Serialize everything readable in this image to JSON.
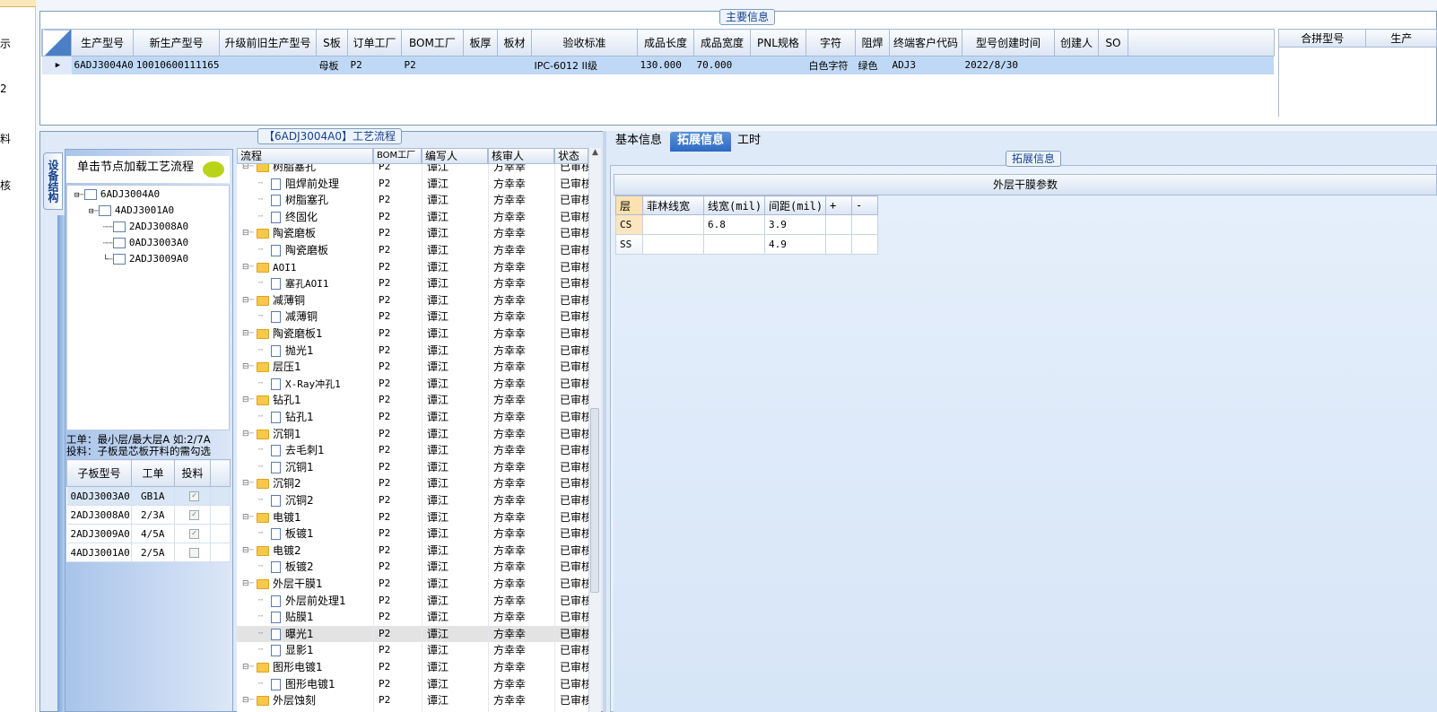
{
  "left_strip": {
    "stub1": "示",
    "stub2": "2",
    "stub3": "料",
    "stub4": "核"
  },
  "main_legend": "主要信息",
  "main_table": {
    "headers": [
      "生产型号",
      "新生产型号",
      "升级前旧生产型号",
      "S板",
      "订单工厂",
      "BOM工厂",
      "板厚",
      "板材",
      "验收标准",
      "成品长度",
      "成品宽度",
      "PNL规格",
      "字符",
      "阻焊",
      "终端客户代码",
      "型号创建时间",
      "创建人",
      "SO"
    ],
    "row": [
      "6ADJ3004A0",
      "10010600111165",
      "",
      "母板",
      "P2",
      "P2",
      "",
      "",
      "IPC-6012 II级",
      "130.000",
      "70.000",
      "",
      "白色字符",
      "绿色",
      "ADJ3",
      "2022/8/30",
      "",
      ""
    ]
  },
  "right_header": {
    "col1": "合拼型号",
    "col2": "生产"
  },
  "process_legend": "【6ADJ3004A0】工艺流程",
  "vtab_label": "设备结构",
  "tree_title": "单击节点加载工艺流程",
  "tree": {
    "root": "6ADJ3004A0",
    "child": "4ADJ3001A0",
    "leaf1": "2ADJ3008A0",
    "leaf2": "0ADJ3003A0",
    "leaf3": "2ADJ3009A0"
  },
  "info_line1": "工单：最小层/最大层A 如:2/7A",
  "info_line2": "投料：子板是芯板开料的需勾选",
  "sub_table": {
    "headers": [
      "子板型号",
      "工单",
      "投料"
    ],
    "rows": [
      {
        "model": "0ADJ3003A0",
        "order": "GB1A",
        "checked": true
      },
      {
        "model": "2ADJ3008A0",
        "order": "2/3A",
        "checked": true
      },
      {
        "model": "2ADJ3009A0",
        "order": "4/5A",
        "checked": true
      },
      {
        "model": "4ADJ3001A0",
        "order": "2/5A",
        "checked": false
      }
    ]
  },
  "process_headers": [
    "流程",
    "BOM工厂",
    "编写人",
    "核审人",
    "状态"
  ],
  "process_rows": [
    {
      "name": "树脂塞孔",
      "type": "folder",
      "bom": "P2",
      "writer": "谭江",
      "reviewer": "方幸幸",
      "status": "已审核"
    },
    {
      "name": "阻焊前处理",
      "type": "doc",
      "bom": "P2",
      "writer": "谭江",
      "reviewer": "方幸幸",
      "status": "已审核"
    },
    {
      "name": "树脂塞孔",
      "type": "doc",
      "bom": "P2",
      "writer": "谭江",
      "reviewer": "方幸幸",
      "status": "已审核"
    },
    {
      "name": "终固化",
      "type": "doc",
      "bom": "P2",
      "writer": "谭江",
      "reviewer": "方幸幸",
      "status": "已审核"
    },
    {
      "name": "陶瓷磨板",
      "type": "folder",
      "bom": "P2",
      "writer": "谭江",
      "reviewer": "方幸幸",
      "status": "已审核"
    },
    {
      "name": "陶瓷磨板",
      "type": "doc",
      "bom": "P2",
      "writer": "谭江",
      "reviewer": "方幸幸",
      "status": "已审核"
    },
    {
      "name": "AOI1",
      "type": "folder",
      "bom": "P2",
      "writer": "谭江",
      "reviewer": "方幸幸",
      "status": "已审核"
    },
    {
      "name": "塞孔AOI1",
      "type": "doc",
      "bom": "P2",
      "writer": "谭江",
      "reviewer": "方幸幸",
      "status": "已审核"
    },
    {
      "name": "减薄铜",
      "type": "folder",
      "bom": "P2",
      "writer": "谭江",
      "reviewer": "方幸幸",
      "status": "已审核"
    },
    {
      "name": "减薄铜",
      "type": "doc",
      "bom": "P2",
      "writer": "谭江",
      "reviewer": "方幸幸",
      "status": "已审核"
    },
    {
      "name": "陶瓷磨板1",
      "type": "folder",
      "bom": "P2",
      "writer": "谭江",
      "reviewer": "方幸幸",
      "status": "已审核"
    },
    {
      "name": "抛光1",
      "type": "doc",
      "bom": "P2",
      "writer": "谭江",
      "reviewer": "方幸幸",
      "status": "已审核"
    },
    {
      "name": "层压1",
      "type": "folder",
      "bom": "P2",
      "writer": "谭江",
      "reviewer": "方幸幸",
      "status": "已审核"
    },
    {
      "name": "X-Ray冲孔1",
      "type": "doc",
      "bom": "P2",
      "writer": "谭江",
      "reviewer": "方幸幸",
      "status": "已审核"
    },
    {
      "name": "钻孔1",
      "type": "folder",
      "bom": "P2",
      "writer": "谭江",
      "reviewer": "方幸幸",
      "status": "已审核"
    },
    {
      "name": "钻孔1",
      "type": "doc",
      "bom": "P2",
      "writer": "谭江",
      "reviewer": "方幸幸",
      "status": "已审核"
    },
    {
      "name": "沉铜1",
      "type": "folder",
      "bom": "P2",
      "writer": "谭江",
      "reviewer": "方幸幸",
      "status": "已审核"
    },
    {
      "name": "去毛刺1",
      "type": "doc",
      "bom": "P2",
      "writer": "谭江",
      "reviewer": "方幸幸",
      "status": "已审核"
    },
    {
      "name": "沉铜1",
      "type": "doc",
      "bom": "P2",
      "writer": "谭江",
      "reviewer": "方幸幸",
      "status": "已审核"
    },
    {
      "name": "沉铜2",
      "type": "folder",
      "bom": "P2",
      "writer": "谭江",
      "reviewer": "方幸幸",
      "status": "已审核"
    },
    {
      "name": "沉铜2",
      "type": "doc",
      "bom": "P2",
      "writer": "谭江",
      "reviewer": "方幸幸",
      "status": "已审核"
    },
    {
      "name": "电镀1",
      "type": "folder",
      "bom": "P2",
      "writer": "谭江",
      "reviewer": "方幸幸",
      "status": "已审核"
    },
    {
      "name": "板镀1",
      "type": "doc",
      "bom": "P2",
      "writer": "谭江",
      "reviewer": "方幸幸",
      "status": "已审核"
    },
    {
      "name": "电镀2",
      "type": "folder",
      "bom": "P2",
      "writer": "谭江",
      "reviewer": "方幸幸",
      "status": "已审核"
    },
    {
      "name": "板镀2",
      "type": "doc",
      "bom": "P2",
      "writer": "谭江",
      "reviewer": "方幸幸",
      "status": "已审核"
    },
    {
      "name": "外层干膜1",
      "type": "folder",
      "bom": "P2",
      "writer": "谭江",
      "reviewer": "方幸幸",
      "status": "已审核"
    },
    {
      "name": "外层前处理1",
      "type": "doc",
      "bom": "P2",
      "writer": "谭江",
      "reviewer": "方幸幸",
      "status": "已审核"
    },
    {
      "name": "贴膜1",
      "type": "doc",
      "bom": "P2",
      "writer": "谭江",
      "reviewer": "方幸幸",
      "status": "已审核"
    },
    {
      "name": "曝光1",
      "type": "doc",
      "bom": "P2",
      "writer": "谭江",
      "reviewer": "方幸幸",
      "status": "已审核",
      "selected": true
    },
    {
      "name": "显影1",
      "type": "doc",
      "bom": "P2",
      "writer": "谭江",
      "reviewer": "方幸幸",
      "status": "已审核"
    },
    {
      "name": "图形电镀1",
      "type": "folder",
      "bom": "P2",
      "writer": "谭江",
      "reviewer": "方幸幸",
      "status": "已审核"
    },
    {
      "name": "图形电镀1",
      "type": "doc",
      "bom": "P2",
      "writer": "谭江",
      "reviewer": "方幸幸",
      "status": "已审核"
    },
    {
      "name": "外层蚀刻",
      "type": "folder",
      "bom": "P2",
      "writer": "谭江",
      "reviewer": "方幸幸",
      "status": "已审核"
    }
  ],
  "tabs": {
    "basic": "基本信息",
    "ext": "拓展信息",
    "time": "工时"
  },
  "ext_legend": "拓展信息",
  "grid_title": "外层干膜参数",
  "grid": {
    "headers": [
      "层",
      "菲林线宽",
      "线宽(mil)",
      "间距(mil)",
      "+",
      "-"
    ],
    "rows": [
      {
        "layer": "CS",
        "film": "",
        "width": "6.8",
        "spacing": "3.9"
      },
      {
        "layer": "SS",
        "film": "",
        "width": "",
        "spacing": "4.9"
      }
    ]
  }
}
